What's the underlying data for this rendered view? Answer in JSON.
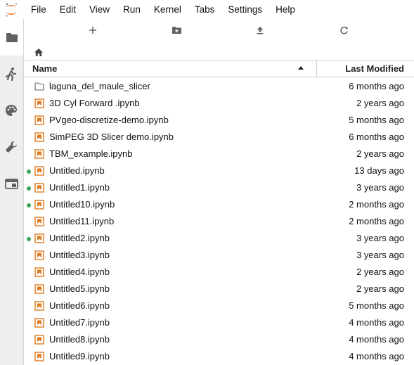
{
  "menu": [
    "File",
    "Edit",
    "View",
    "Run",
    "Kernel",
    "Tabs",
    "Settings",
    "Help"
  ],
  "colors": {
    "notebook_icon": "#e07a1f",
    "running_dot": "#3ca55c",
    "logo_orange": "#f37726",
    "icon_gray": "#616161"
  },
  "sidebar": {
    "tabs": [
      "folder-icon",
      "running-icon",
      "palette-icon",
      "wrench-icon",
      "tabs-icon"
    ],
    "active": 0
  },
  "toolbar": {
    "buttons": [
      "new-launcher-icon",
      "new-folder-icon",
      "upload-icon",
      "refresh-icon"
    ]
  },
  "breadcrumb": {
    "icon": "home-icon"
  },
  "listing": {
    "header": {
      "name": "Name",
      "modified": "Last Modified"
    },
    "files": [
      {
        "name": "laguna_del_maule_slicer",
        "type": "folder",
        "running": false,
        "modified": "6 months ago"
      },
      {
        "name": "3D Cyl Forward .ipynb",
        "type": "notebook",
        "running": false,
        "modified": "2 years ago"
      },
      {
        "name": "PVgeo-discretize-demo.ipynb",
        "type": "notebook",
        "running": false,
        "modified": "5 months ago"
      },
      {
        "name": "SimPEG 3D Slicer demo.ipynb",
        "type": "notebook",
        "running": false,
        "modified": "6 months ago"
      },
      {
        "name": "TBM_example.ipynb",
        "type": "notebook",
        "running": false,
        "modified": "2 years ago"
      },
      {
        "name": "Untitled.ipynb",
        "type": "notebook",
        "running": true,
        "modified": "13 days ago"
      },
      {
        "name": "Untitled1.ipynb",
        "type": "notebook",
        "running": true,
        "modified": "3 years ago"
      },
      {
        "name": "Untitled10.ipynb",
        "type": "notebook",
        "running": true,
        "modified": "2 months ago"
      },
      {
        "name": "Untitled11.ipynb",
        "type": "notebook",
        "running": false,
        "modified": "2 months ago"
      },
      {
        "name": "Untitled2.ipynb",
        "type": "notebook",
        "running": true,
        "modified": "3 years ago"
      },
      {
        "name": "Untitled3.ipynb",
        "type": "notebook",
        "running": false,
        "modified": "3 years ago"
      },
      {
        "name": "Untitled4.ipynb",
        "type": "notebook",
        "running": false,
        "modified": "2 years ago"
      },
      {
        "name": "Untitled5.ipynb",
        "type": "notebook",
        "running": false,
        "modified": "2 years ago"
      },
      {
        "name": "Untitled6.ipynb",
        "type": "notebook",
        "running": false,
        "modified": "5 months ago"
      },
      {
        "name": "Untitled7.ipynb",
        "type": "notebook",
        "running": false,
        "modified": "4 months ago"
      },
      {
        "name": "Untitled8.ipynb",
        "type": "notebook",
        "running": false,
        "modified": "4 months ago"
      },
      {
        "name": "Untitled9.ipynb",
        "type": "notebook",
        "running": false,
        "modified": "4 months ago"
      }
    ]
  }
}
